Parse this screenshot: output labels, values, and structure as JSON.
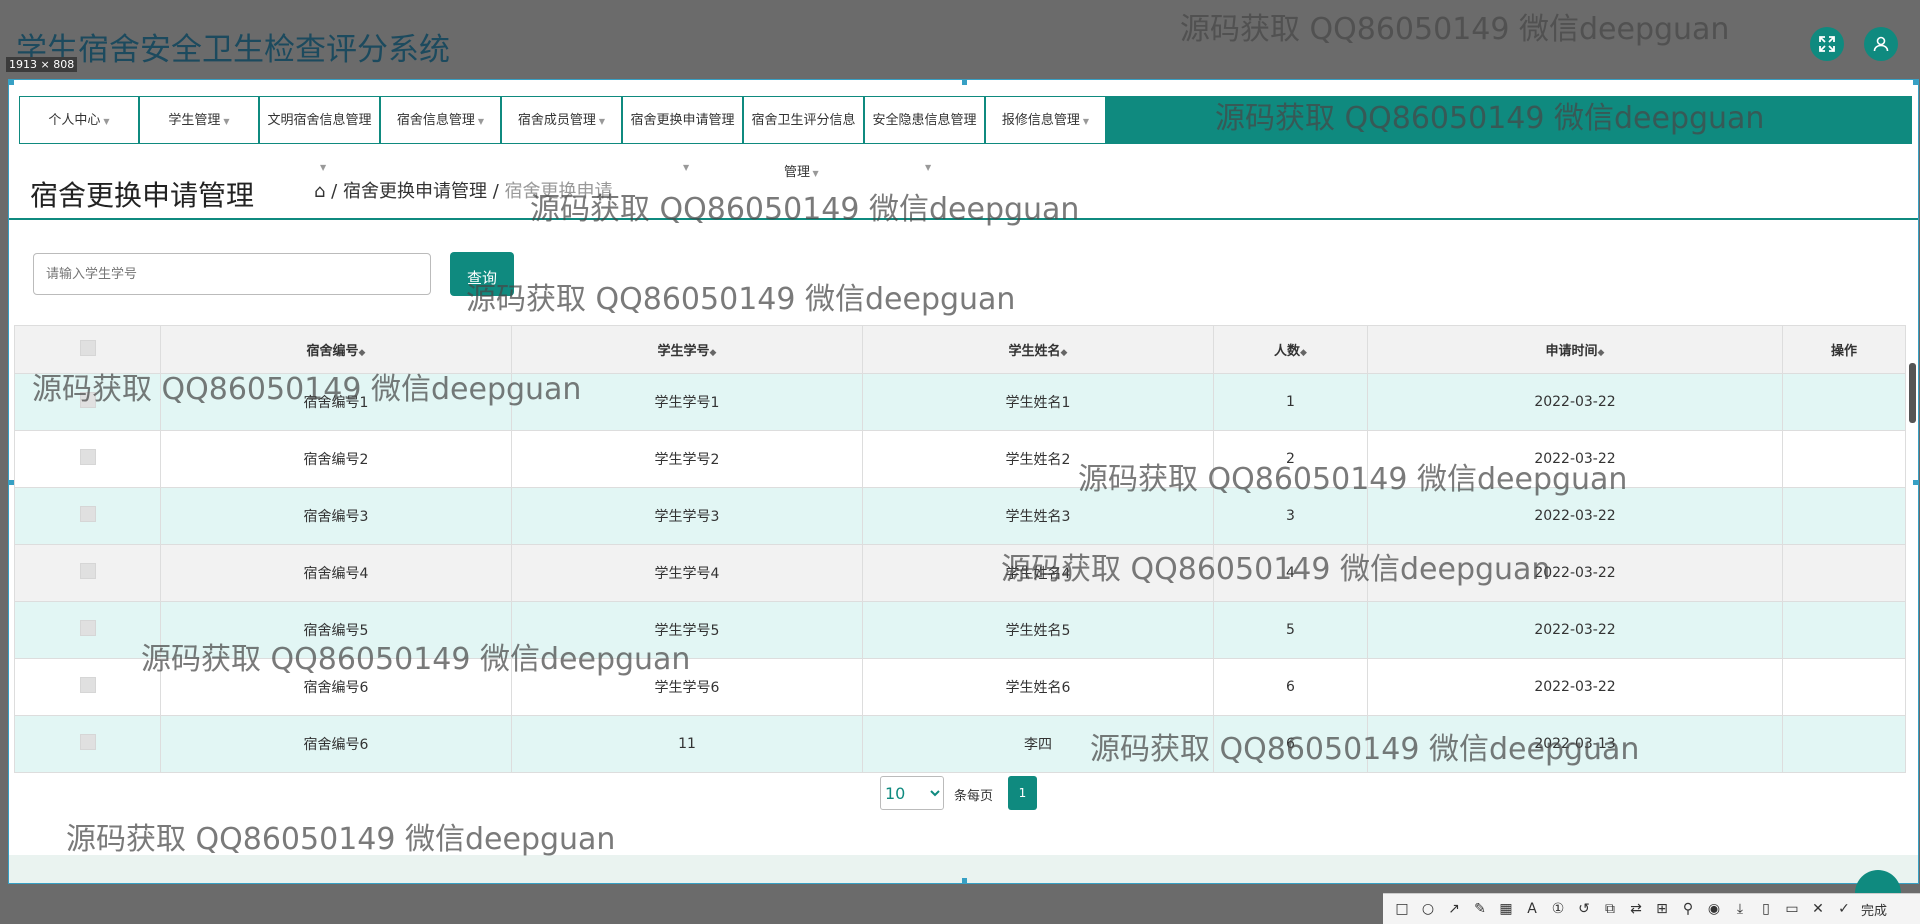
{
  "app": {
    "title": "学生宿舍安全卫生检查评分系统",
    "size_badge": "1913 × 808"
  },
  "watermark": "源码获取 QQ86050149 微信deepguan",
  "nav": {
    "items": [
      {
        "label": "个人中心"
      },
      {
        "label": "学生管理"
      },
      {
        "label": "文明宿舍信息管理"
      },
      {
        "label": "宿舍信息管理"
      },
      {
        "label": "宿舍成员管理"
      },
      {
        "label": "宿舍更换申请管理"
      },
      {
        "label": "宿舍卫生评分信息"
      },
      {
        "label": "安全隐患信息管理"
      },
      {
        "label": "报修信息管理"
      }
    ],
    "continuation": "管理"
  },
  "page": {
    "title": "宿舍更换申请管理",
    "breadcrumb_home": "⌂",
    "breadcrumb_sep": "/",
    "breadcrumb_parent": "宿舍更换申请管理",
    "breadcrumb_current": "宿舍更换申请"
  },
  "search": {
    "placeholder": "请输入学生学号",
    "button": "查询"
  },
  "table": {
    "columns": [
      "宿舍编号",
      "学生学号",
      "学生姓名",
      "人数",
      "申请时间",
      "操作"
    ],
    "sort_icon": "◆",
    "rows": [
      {
        "dorm": "宿舍编号1",
        "sid": "学生学号1",
        "name": "学生姓名1",
        "count": "1",
        "date": "2022-03-22"
      },
      {
        "dorm": "宿舍编号2",
        "sid": "学生学号2",
        "name": "学生姓名2",
        "count": "2",
        "date": "2022-03-22"
      },
      {
        "dorm": "宿舍编号3",
        "sid": "学生学号3",
        "name": "学生姓名3",
        "count": "3",
        "date": "2022-03-22"
      },
      {
        "dorm": "宿舍编号4",
        "sid": "学生学号4",
        "name": "学生姓名4",
        "count": "4",
        "date": "2022-03-22"
      },
      {
        "dorm": "宿舍编号5",
        "sid": "学生学号5",
        "name": "学生姓名5",
        "count": "5",
        "date": "2022-03-22"
      },
      {
        "dorm": "宿舍编号6",
        "sid": "学生学号6",
        "name": "学生姓名6",
        "count": "6",
        "date": "2022-03-22"
      },
      {
        "dorm": "宿舍编号6",
        "sid": "11",
        "name": "李四",
        "count": "6",
        "date": "2022-03-13"
      }
    ]
  },
  "pager": {
    "page_size": "10",
    "label": "条每页",
    "current_page": "1"
  },
  "toolbar": {
    "done_label": "完成"
  },
  "colors": {
    "primary": "#0f8a7f",
    "row_stripe": "#e2f6f4"
  }
}
